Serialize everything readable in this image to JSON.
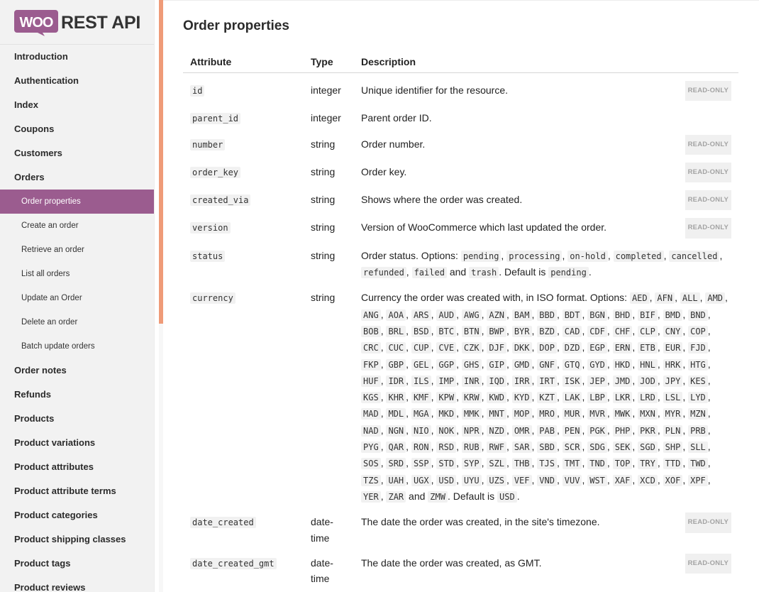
{
  "logo": {
    "badge": "WOO",
    "text": "REST API"
  },
  "sidebar": {
    "items": [
      {
        "label": "Introduction",
        "level": 1,
        "active": false
      },
      {
        "label": "Authentication",
        "level": 1,
        "active": false
      },
      {
        "label": "Index",
        "level": 1,
        "active": false
      },
      {
        "label": "Coupons",
        "level": 1,
        "active": false
      },
      {
        "label": "Customers",
        "level": 1,
        "active": false
      },
      {
        "label": "Orders",
        "level": 1,
        "active": false
      },
      {
        "label": "Order properties",
        "level": 2,
        "active": true
      },
      {
        "label": "Create an order",
        "level": 2,
        "active": false
      },
      {
        "label": "Retrieve an order",
        "level": 2,
        "active": false
      },
      {
        "label": "List all orders",
        "level": 2,
        "active": false
      },
      {
        "label": "Update an Order",
        "level": 2,
        "active": false
      },
      {
        "label": "Delete an order",
        "level": 2,
        "active": false
      },
      {
        "label": "Batch update orders",
        "level": 2,
        "active": false
      },
      {
        "label": "Order notes",
        "level": 1,
        "active": false
      },
      {
        "label": "Refunds",
        "level": 1,
        "active": false
      },
      {
        "label": "Products",
        "level": 1,
        "active": false
      },
      {
        "label": "Product variations",
        "level": 1,
        "active": false
      },
      {
        "label": "Product attributes",
        "level": 1,
        "active": false
      },
      {
        "label": "Product attribute terms",
        "level": 1,
        "active": false
      },
      {
        "label": "Product categories",
        "level": 1,
        "active": false
      },
      {
        "label": "Product shipping classes",
        "level": 1,
        "active": false
      },
      {
        "label": "Product tags",
        "level": 1,
        "active": false
      },
      {
        "label": "Product reviews",
        "level": 1,
        "active": false
      }
    ]
  },
  "main": {
    "title": "Order properties",
    "columns": [
      "Attribute",
      "Type",
      "Description"
    ],
    "readonly_label": "READ-ONLY",
    "rows": [
      {
        "attr": "id",
        "type": "integer",
        "desc": [
          {
            "t": "Unique identifier for the resource."
          }
        ],
        "readonly": true
      },
      {
        "attr": "parent_id",
        "type": "integer",
        "desc": [
          {
            "t": "Parent order ID."
          }
        ],
        "readonly": false
      },
      {
        "attr": "number",
        "type": "string",
        "desc": [
          {
            "t": "Order number."
          }
        ],
        "readonly": true
      },
      {
        "attr": "order_key",
        "type": "string",
        "desc": [
          {
            "t": "Order key."
          }
        ],
        "readonly": true
      },
      {
        "attr": "created_via",
        "type": "string",
        "desc": [
          {
            "t": "Shows where the order was created."
          }
        ],
        "readonly": true
      },
      {
        "attr": "version",
        "type": "string",
        "desc": [
          {
            "t": "Version of WooCommerce which last updated the order."
          }
        ],
        "readonly": true
      },
      {
        "attr": "status",
        "type": "string",
        "desc": [
          {
            "t": "Order status. Options: "
          },
          {
            "c": "pending"
          },
          {
            "t": ", "
          },
          {
            "c": "processing"
          },
          {
            "t": ", "
          },
          {
            "c": "on-hold"
          },
          {
            "t": ", "
          },
          {
            "c": "completed"
          },
          {
            "t": ", "
          },
          {
            "c": "cancelled"
          },
          {
            "t": ", "
          },
          {
            "c": "refunded"
          },
          {
            "t": ", "
          },
          {
            "c": "failed"
          },
          {
            "t": " and "
          },
          {
            "c": "trash"
          },
          {
            "t": ". Default is "
          },
          {
            "c": "pending"
          },
          {
            "t": "."
          }
        ],
        "readonly": false
      },
      {
        "attr": "currency",
        "type": "string",
        "desc": [
          {
            "t": "Currency the order was created with, in ISO format. Options: "
          },
          {
            "list": [
              "AED",
              "AFN",
              "ALL",
              "AMD",
              "ANG",
              "AOA",
              "ARS",
              "AUD",
              "AWG",
              "AZN",
              "BAM",
              "BBD",
              "BDT",
              "BGN",
              "BHD",
              "BIF",
              "BMD",
              "BND",
              "BOB",
              "BRL",
              "BSD",
              "BTC",
              "BTN",
              "BWP",
              "BYR",
              "BZD",
              "CAD",
              "CDF",
              "CHF",
              "CLP",
              "CNY",
              "COP",
              "CRC",
              "CUC",
              "CUP",
              "CVE",
              "CZK",
              "DJF",
              "DKK",
              "DOP",
              "DZD",
              "EGP",
              "ERN",
              "ETB",
              "EUR",
              "FJD",
              "FKP",
              "GBP",
              "GEL",
              "GGP",
              "GHS",
              "GIP",
              "GMD",
              "GNF",
              "GTQ",
              "GYD",
              "HKD",
              "HNL",
              "HRK",
              "HTG",
              "HUF",
              "IDR",
              "ILS",
              "IMP",
              "INR",
              "IQD",
              "IRR",
              "IRT",
              "ISK",
              "JEP",
              "JMD",
              "JOD",
              "JPY",
              "KES",
              "KGS",
              "KHR",
              "KMF",
              "KPW",
              "KRW",
              "KWD",
              "KYD",
              "KZT",
              "LAK",
              "LBP",
              "LKR",
              "LRD",
              "LSL",
              "LYD",
              "MAD",
              "MDL",
              "MGA",
              "MKD",
              "MMK",
              "MNT",
              "MOP",
              "MRO",
              "MUR",
              "MVR",
              "MWK",
              "MXN",
              "MYR",
              "MZN",
              "NAD",
              "NGN",
              "NIO",
              "NOK",
              "NPR",
              "NZD",
              "OMR",
              "PAB",
              "PEN",
              "PGK",
              "PHP",
              "PKR",
              "PLN",
              "PRB",
              "PYG",
              "QAR",
              "RON",
              "RSD",
              "RUB",
              "RWF",
              "SAR",
              "SBD",
              "SCR",
              "SDG",
              "SEK",
              "SGD",
              "SHP",
              "SLL",
              "SOS",
              "SRD",
              "SSP",
              "STD",
              "SYP",
              "SZL",
              "THB",
              "TJS",
              "TMT",
              "TND",
              "TOP",
              "TRY",
              "TTD",
              "TWD",
              "TZS",
              "UAH",
              "UGX",
              "USD",
              "UYU",
              "UZS",
              "VEF",
              "VND",
              "VUV",
              "WST",
              "XAF",
              "XCD",
              "XOF",
              "XPF",
              "YER",
              "ZAR"
            ]
          },
          {
            "t": " and "
          },
          {
            "c": "ZMW"
          },
          {
            "t": ". Default is "
          },
          {
            "c": "USD"
          },
          {
            "t": "."
          }
        ],
        "readonly": false
      },
      {
        "attr": "date_created",
        "type": "date-time",
        "desc": [
          {
            "t": "The date the order was created, in the site's timezone."
          }
        ],
        "readonly": true
      },
      {
        "attr": "date_created_gmt",
        "type": "date-time",
        "desc": [
          {
            "t": "The date the order was created, as GMT."
          }
        ],
        "readonly": true
      }
    ]
  },
  "colors": {
    "accent": "#9b5c8f",
    "scrollbar": "#ef9b78"
  }
}
